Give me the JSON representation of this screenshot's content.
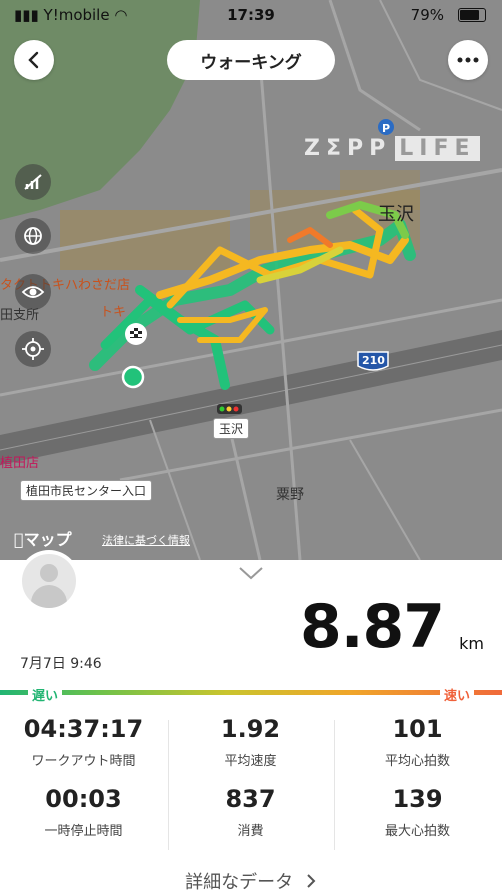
{
  "status_bar": {
    "carrier": "Y!mobile",
    "time": "17:39",
    "battery": "79%"
  },
  "header": {
    "title": "ウォーキング",
    "back_icon": "chevron-left-icon",
    "more_icon": "ellipsis-icon"
  },
  "map": {
    "brand_left": "ZΣPP",
    "brand_right": "LIFE",
    "labels": {
      "tamagawa_top": "玉沢",
      "store": "タクトトキハわさだ店",
      "store2": "トキ",
      "office": "田支所",
      "station": "玉沢",
      "route": "210",
      "kurino": "粟野",
      "branch": "植田店",
      "center": "植田市民センター入口"
    },
    "apple_maps": "マップ",
    "legal": "法律に基づく情報"
  },
  "summary": {
    "date": "7月7日 9:46",
    "distance": "8.87",
    "unit": "km",
    "slow": "遅い",
    "fast": "速い"
  },
  "stats": [
    {
      "value": "04:37:17",
      "label": "ワークアウト時間"
    },
    {
      "value": "1.92",
      "label": "平均速度"
    },
    {
      "value": "101",
      "label": "平均心拍数"
    },
    {
      "value": "00:03",
      "label": "一時停止時間"
    },
    {
      "value": "837",
      "label": "消費"
    },
    {
      "value": "139",
      "label": "最大心拍数"
    }
  ],
  "detail_link": "詳細なデータ",
  "colors": {
    "slow": "#22b573",
    "fast": "#f0613a",
    "track_green": "#22c27a",
    "track_yellow": "#f5b821",
    "track_orange": "#f07a2a"
  }
}
